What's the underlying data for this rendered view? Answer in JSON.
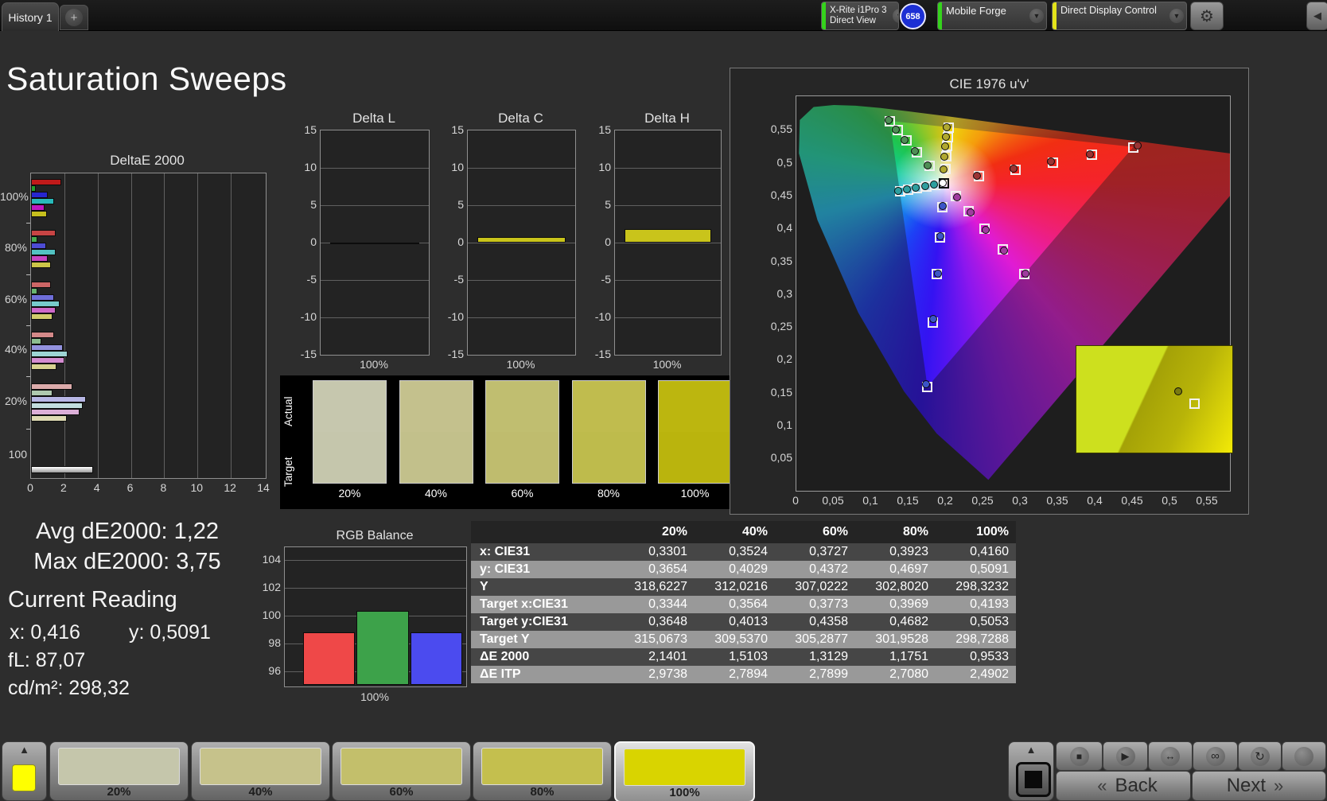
{
  "top_bar": {
    "history_tab": "History 1",
    "meter": {
      "line1": "X-Rite i1Pro 3",
      "line2": "Direct View",
      "badge": "658",
      "indicator_color": "#35d31c"
    },
    "source": {
      "label": "Mobile Forge",
      "indicator_color": "#35d31c"
    },
    "workflow": {
      "label": "Direct Display Control",
      "indicator_color": "#e3e31a"
    }
  },
  "title": "Saturation Sweeps",
  "glyphs": {
    "plus": "+",
    "chevron_down": "▼",
    "gear": "⚙",
    "chevron_left": "◀",
    "up_arrow": "▲",
    "stop": "■",
    "play": "▶",
    "step": "↔",
    "infinity": "∞",
    "refresh": "↻",
    "back_chevrons": "«",
    "next_chevrons": "»"
  },
  "stats": {
    "avg": "Avg dE2000: 1,22",
    "max": "Max dE2000: 3,75",
    "current_heading": "Current Reading",
    "x": "x: 0,416",
    "y": "y: 0,5091",
    "fl": "fL: 87,07",
    "cd": "cd/m²: 298,32"
  },
  "chart_data": [
    {
      "id": "deltaE2000",
      "type": "bar",
      "title": "DeltaE 2000",
      "orientation": "horizontal",
      "xlim": [
        0,
        14
      ],
      "xticks": [
        0,
        2,
        4,
        6,
        8,
        10,
        12,
        14
      ],
      "groups": [
        {
          "label": "100%",
          "values": [
            1.8,
            0.3,
            1.0,
            1.4,
            0.8,
            0.95
          ],
          "colors": [
            "#c01a1a",
            "#22a12c",
            "#2726cf",
            "#28b9b9",
            "#bf17bf",
            "#c6bf1d"
          ]
        },
        {
          "label": "80%",
          "values": [
            1.5,
            0.4,
            0.9,
            1.5,
            1.0,
            1.18
          ],
          "colors": [
            "#c74444",
            "#46ab4e",
            "#4d4cd4",
            "#52c2c2",
            "#c744c2",
            "#ccc548"
          ]
        },
        {
          "label": "60%",
          "values": [
            1.2,
            0.4,
            1.4,
            1.7,
            1.5,
            1.31
          ],
          "colors": [
            "#cd6666",
            "#68b46e",
            "#6f6ed9",
            "#77cbcb",
            "#cd68c8",
            "#d1cb6c"
          ]
        },
        {
          "label": "40%",
          "values": [
            1.4,
            0.6,
            1.9,
            2.2,
            2.0,
            1.51
          ],
          "colors": [
            "#d48989",
            "#8cbe90",
            "#9392de",
            "#9dd4d4",
            "#d48cd0",
            "#d7d290"
          ]
        },
        {
          "label": "20%",
          "values": [
            2.5,
            1.3,
            3.3,
            3.1,
            2.9,
            2.14
          ],
          "colors": [
            "#dcabab",
            "#afc9af",
            "#b7b6e4",
            "#c2dede",
            "#dcafd8",
            "#dedab3"
          ]
        },
        {
          "label": "100",
          "values": [
            3.75
          ],
          "colors": [
            "#f4f4f4"
          ]
        }
      ]
    },
    {
      "id": "deltaL",
      "type": "bar",
      "title": "Delta L",
      "ylim": [
        -15,
        15
      ],
      "yticks": [
        15,
        10,
        5,
        0,
        -5,
        -10,
        -15
      ],
      "xlabel": "100%",
      "values": [
        -0.2
      ],
      "colors": [
        "#0a0a0a"
      ]
    },
    {
      "id": "deltaC",
      "type": "bar",
      "title": "Delta C",
      "ylim": [
        -15,
        15
      ],
      "yticks": [
        15,
        10,
        5,
        0,
        -5,
        -10,
        -15
      ],
      "xlabel": "100%",
      "values": [
        0.7
      ],
      "colors": [
        "#c9c41b"
      ]
    },
    {
      "id": "deltaH",
      "type": "bar",
      "title": "Delta H",
      "ylim": [
        -15,
        15
      ],
      "yticks": [
        15,
        10,
        5,
        0,
        -5,
        -10,
        -15
      ],
      "xlabel": "100%",
      "values": [
        1.8
      ],
      "colors": [
        "#c9c41b"
      ]
    },
    {
      "id": "patchCompare",
      "type": "table",
      "row_labels": [
        "Actual",
        "Target"
      ],
      "levels": [
        "20%",
        "40%",
        "60%",
        "80%",
        "100%"
      ],
      "actual_colors": [
        "#c6c7ae",
        "#c4c18d",
        "#c0be70",
        "#c0bc4e",
        "#bcb60f"
      ],
      "target_colors": [
        "#c5c6ac",
        "#c2c08b",
        "#bfbc6e",
        "#bebb4c",
        "#bab40d"
      ]
    },
    {
      "id": "cie",
      "type": "scatter",
      "title": "CIE 1976 u'v'",
      "xlim": [
        0,
        0.58
      ],
      "ylim": [
        0,
        0.6
      ],
      "xtick_labels": [
        "0",
        "0,05",
        "0,1",
        "0,15",
        "0,2",
        "0,25",
        "0,3",
        "0,35",
        "0,4",
        "0,45",
        "0,5",
        "0,55"
      ],
      "ytick_labels": [
        "0,55",
        "0,5",
        "0,45",
        "0,4",
        "0,35",
        "0,3",
        "0,25",
        "0,2",
        "0,15",
        "0,1",
        "0,05"
      ],
      "white_point": {
        "target": [
          0.1978,
          0.4683
        ],
        "measured": [
          0.196,
          0.469
        ]
      },
      "series": [
        {
          "name": "red",
          "color": "#9b3434",
          "targets": [
            [
              0.2442,
              0.4783
            ],
            [
              0.2926,
              0.4888
            ],
            [
              0.343,
              0.4996
            ],
            [
              0.3956,
              0.511
            ],
            [
              0.4507,
              0.5229
            ]
          ],
          "measured": [
            [
              0.241,
              0.48
            ],
            [
              0.29,
              0.4905
            ],
            [
              0.34,
              0.501
            ],
            [
              0.393,
              0.5125
            ],
            [
              0.456,
              0.525
            ]
          ]
        },
        {
          "name": "green",
          "color": "#4e8e55",
          "targets": [
            [
              0.1778,
              0.4942
            ],
            [
              0.1612,
              0.5157
            ],
            [
              0.1472,
              0.5338
            ],
            [
              0.1353,
              0.5492
            ],
            [
              0.125,
              0.5625
            ]
          ],
          "measured": [
            [
              0.176,
              0.495
            ],
            [
              0.159,
              0.5165
            ],
            [
              0.145,
              0.5345
            ],
            [
              0.133,
              0.55
            ],
            [
              0.123,
              0.564
            ]
          ]
        },
        {
          "name": "blue",
          "color": "#3c55c8",
          "targets": [
            [
              0.1952,
              0.4313
            ],
            [
              0.1919,
              0.386
            ],
            [
              0.1878,
              0.3293
            ],
            [
              0.1825,
              0.256
            ],
            [
              0.1754,
              0.1579
            ]
          ],
          "measured": [
            [
              0.196,
              0.433
            ],
            [
              0.193,
              0.388
            ],
            [
              0.189,
              0.331
            ],
            [
              0.183,
              0.262
            ],
            [
              0.173,
              0.162
            ]
          ]
        },
        {
          "name": "cyan",
          "color": "#2e9f9f",
          "targets": [
            [
              0.1857,
              0.4657
            ],
            [
              0.1737,
              0.4631
            ],
            [
              0.1617,
              0.4605
            ],
            [
              0.1499,
              0.458
            ],
            [
              0.1383,
              0.4554
            ]
          ],
          "measured": [
            [
              0.184,
              0.466
            ],
            [
              0.172,
              0.4635
            ],
            [
              0.16,
              0.461
            ],
            [
              0.148,
              0.4585
            ],
            [
              0.136,
              0.456
            ]
          ]
        },
        {
          "name": "magenta",
          "color": "#9f3c9f",
          "targets": [
            [
              0.2131,
              0.4485
            ],
            [
              0.2308,
              0.4257
            ],
            [
              0.2514,
              0.3991
            ],
            [
              0.2758,
              0.3676
            ],
            [
              0.305,
              0.3298
            ]
          ],
          "measured": [
            [
              0.215,
              0.447
            ],
            [
              0.233,
              0.424
            ],
            [
              0.253,
              0.3975
            ],
            [
              0.278,
              0.366
            ],
            [
              0.306,
              0.331
            ]
          ]
        },
        {
          "name": "yellow",
          "color": "#b0a830",
          "targets": [
            [
              0.1994,
              0.4894
            ],
            [
              0.2007,
              0.5085
            ],
            [
              0.2019,
              0.5247
            ],
            [
              0.2029,
              0.5385
            ],
            [
              0.2039,
              0.5529
            ]
          ],
          "measured": [
            [
              0.1964,
              0.4891
            ],
            [
              0.1977,
              0.5086
            ],
            [
              0.1987,
              0.5246
            ],
            [
              0.1999,
              0.5384
            ],
            [
              0.201,
              0.5535
            ]
          ]
        }
      ]
    },
    {
      "id": "rgbBalance",
      "type": "bar",
      "title": "RGB Balance",
      "categories": [
        "Red",
        "Green",
        "Blue"
      ],
      "values": [
        98.8,
        100.3,
        98.8
      ],
      "colors": [
        "#ef4848",
        "#3da24a",
        "#4b4bef"
      ],
      "ylim": [
        95,
        105
      ],
      "yticks": [
        104,
        102,
        100,
        98,
        96
      ],
      "xlabel": "100%"
    }
  ],
  "table": {
    "columns": [
      "",
      "20%",
      "40%",
      "60%",
      "80%",
      "100%"
    ],
    "rows": [
      {
        "label": "x: CIE31",
        "values": [
          "0,3301",
          "0,3524",
          "0,3727",
          "0,3923",
          "0,4160"
        ]
      },
      {
        "label": "y: CIE31",
        "values": [
          "0,3654",
          "0,4029",
          "0,4372",
          "0,4697",
          "0,5091"
        ]
      },
      {
        "label": "Y",
        "values": [
          "318,6227",
          "312,0216",
          "307,0222",
          "302,8020",
          "298,3232"
        ]
      },
      {
        "label": "Target x:CIE31",
        "values": [
          "0,3344",
          "0,3564",
          "0,3773",
          "0,3969",
          "0,4193"
        ]
      },
      {
        "label": "Target y:CIE31",
        "values": [
          "0,3648",
          "0,4013",
          "0,4358",
          "0,4682",
          "0,5053"
        ]
      },
      {
        "label": "Target Y",
        "values": [
          "315,0673",
          "309,5370",
          "305,2877",
          "301,9528",
          "298,7288"
        ]
      },
      {
        "label": "ΔE 2000",
        "values": [
          "2,1401",
          "1,5103",
          "1,3129",
          "1,1751",
          "0,9533"
        ]
      },
      {
        "label": "ΔE ITP",
        "values": [
          "2,9738",
          "2,7894",
          "2,7899",
          "2,7080",
          "2,4902"
        ]
      }
    ]
  },
  "bottom_bar": {
    "patch_nav_color": "#ffff00",
    "patches": [
      {
        "label": "20%",
        "color": "#c5c6ab",
        "selected": false
      },
      {
        "label": "40%",
        "color": "#c6c28b",
        "selected": false
      },
      {
        "label": "60%",
        "color": "#c3bf6b",
        "selected": false
      },
      {
        "label": "80%",
        "color": "#c4bf4e",
        "selected": false
      },
      {
        "label": "100%",
        "color": "#d9d400",
        "selected": true
      }
    ],
    "back_label": "Back",
    "next_label": "Next"
  }
}
